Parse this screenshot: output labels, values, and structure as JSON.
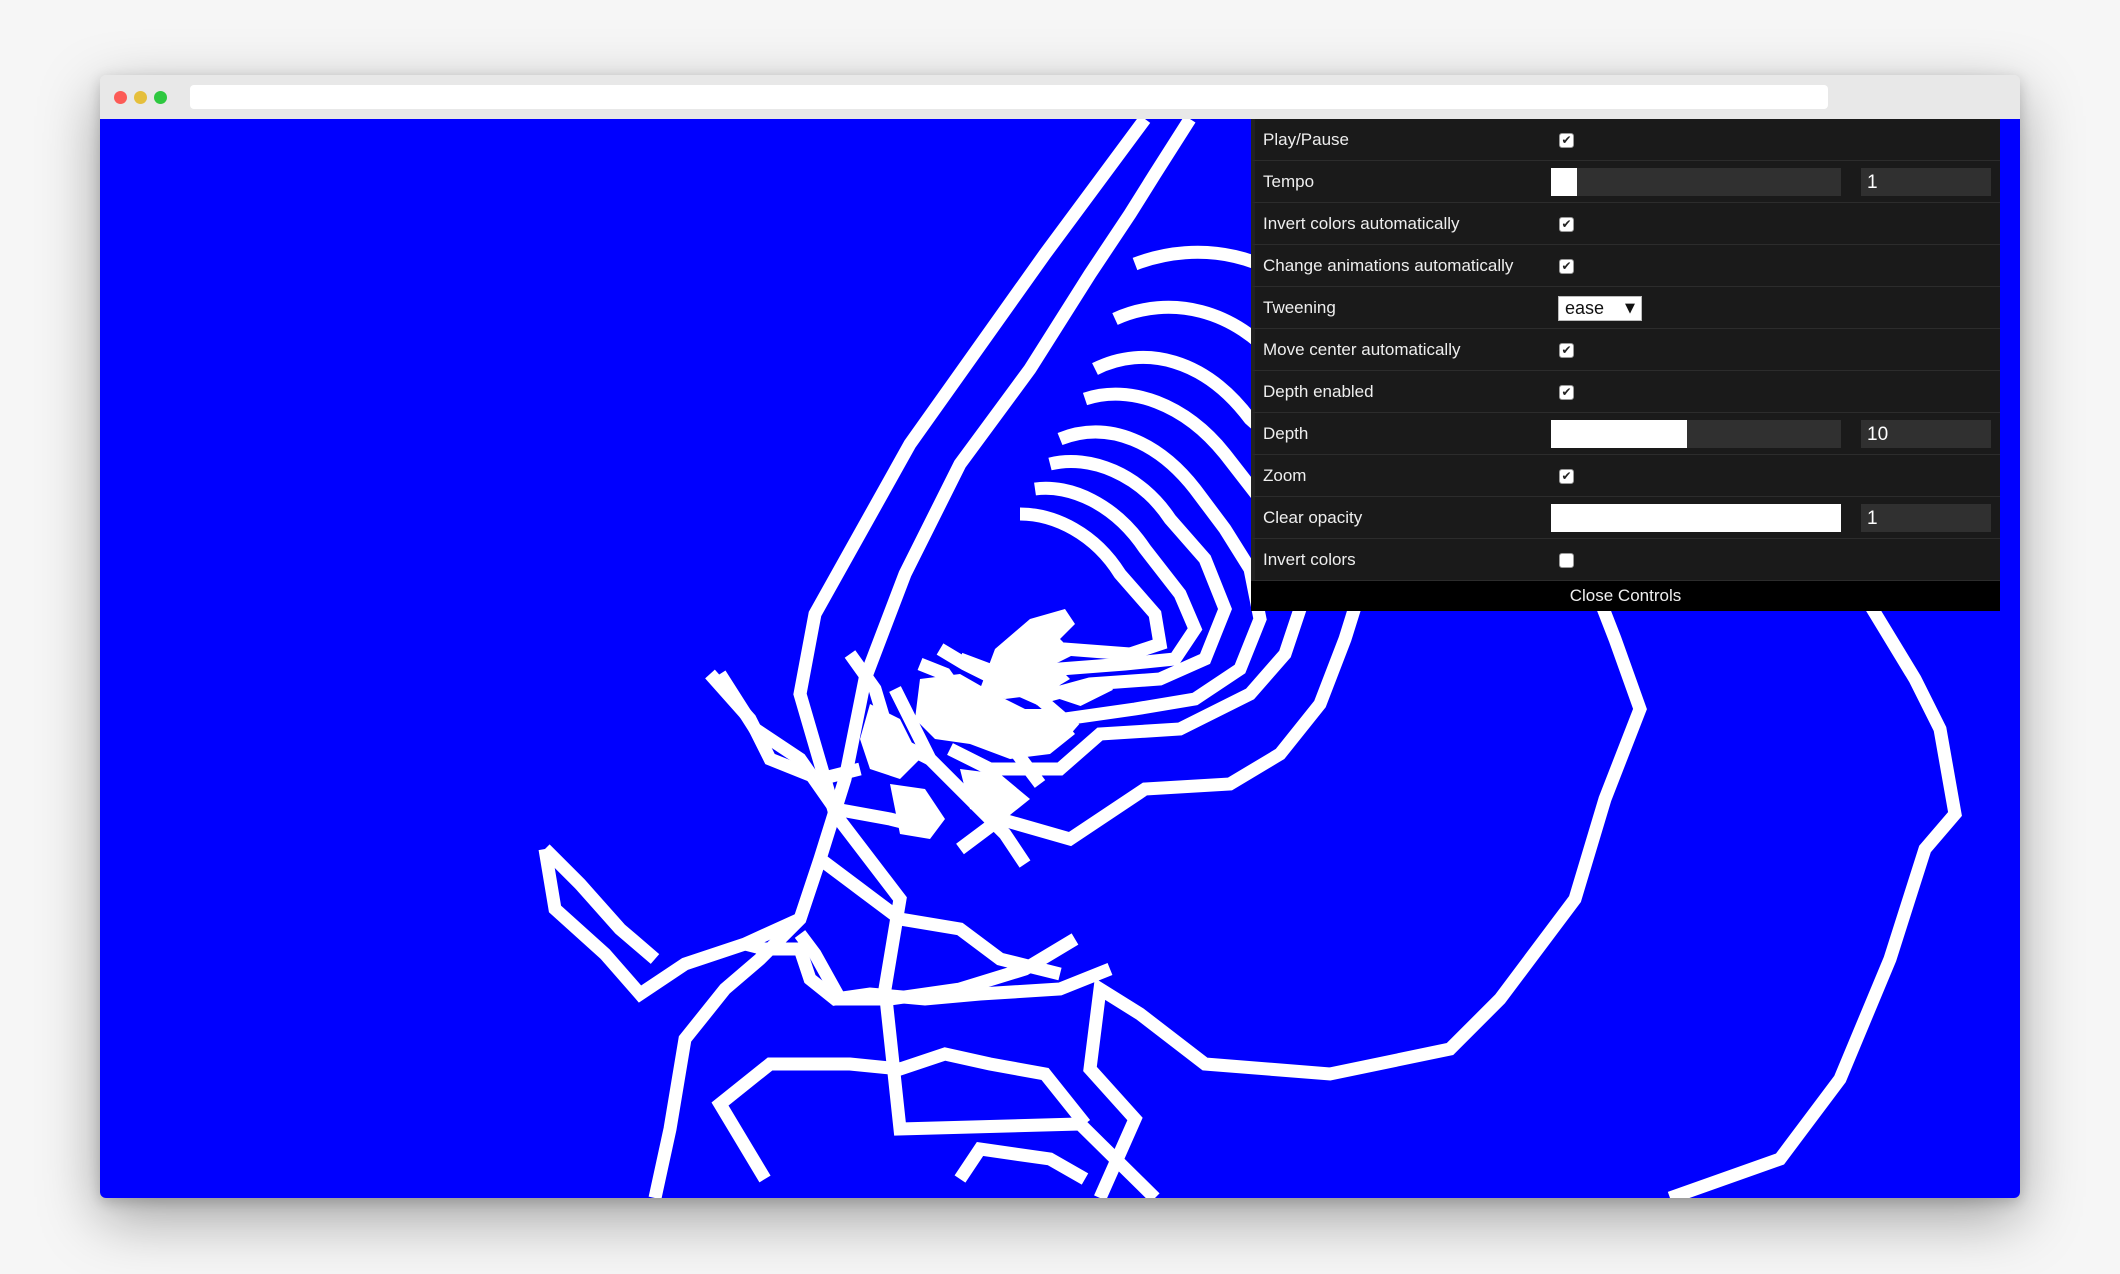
{
  "browser": {
    "url": ""
  },
  "canvas": {
    "background_color": "#0000ff",
    "stroke_color": "#ffffff"
  },
  "controls": {
    "play_pause": {
      "label": "Play/Pause",
      "checked": true
    },
    "tempo": {
      "label": "Tempo",
      "value": "1",
      "fraction": 0.09
    },
    "invert_colors_auto": {
      "label": "Invert colors automatically",
      "checked": true
    },
    "change_animations_auto": {
      "label": "Change animations automatically",
      "checked": true
    },
    "tweening": {
      "label": "Tweening",
      "value": "ease",
      "arrow": "▼"
    },
    "move_center_auto": {
      "label": "Move center automatically",
      "checked": true
    },
    "depth_enabled": {
      "label": "Depth enabled",
      "checked": true
    },
    "depth": {
      "label": "Depth",
      "value": "10",
      "fraction": 0.47
    },
    "zoom": {
      "label": "Zoom",
      "checked": true
    },
    "clear_opacity": {
      "label": "Clear opacity",
      "value": "1",
      "fraction": 1.0
    },
    "invert_colors": {
      "label": "Invert colors",
      "checked": false
    },
    "close_label": "Close Controls"
  }
}
